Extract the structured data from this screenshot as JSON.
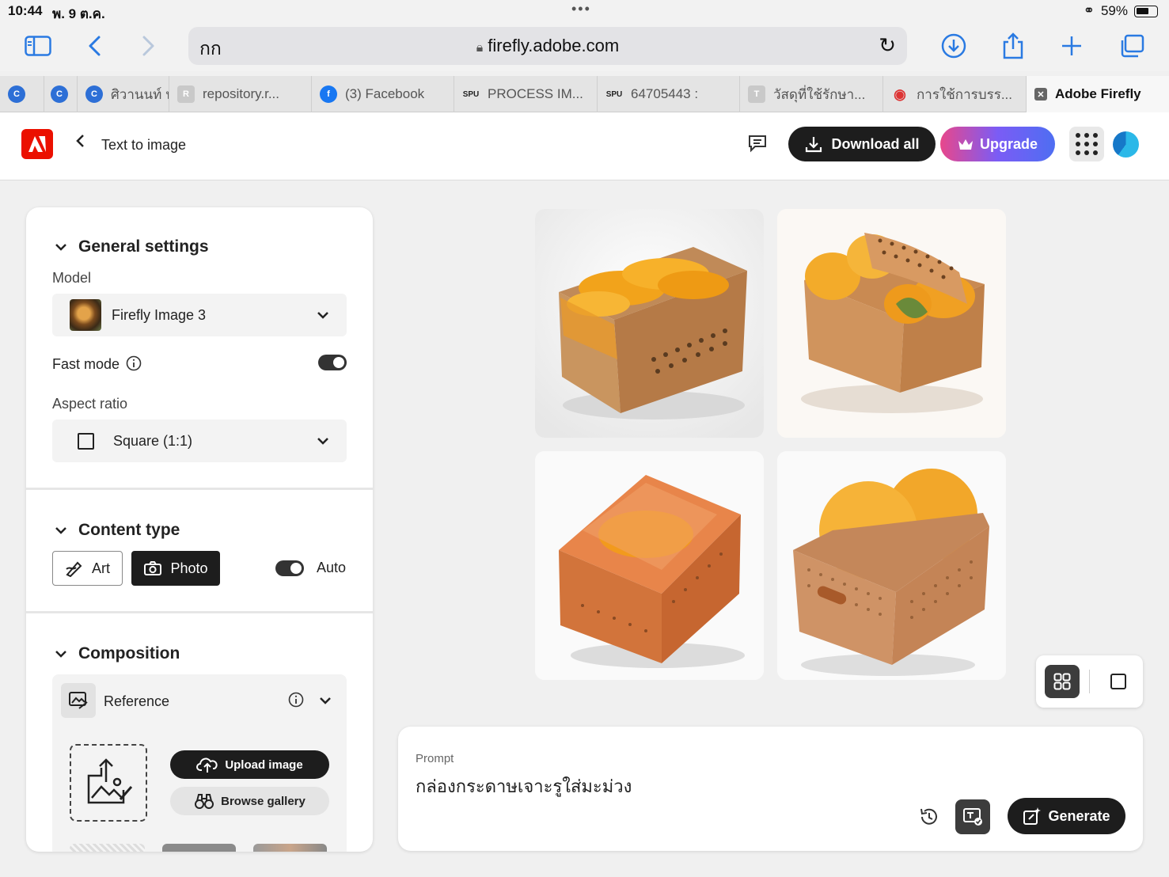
{
  "status": {
    "time": "10:44",
    "date": "พ. 9 ต.ค.",
    "battery": "59%"
  },
  "browser": {
    "aa_label": "กก",
    "url": "firefly.adobe.com",
    "tabs": [
      {
        "label": "",
        "fav": "C",
        "color": "#2d6fd6"
      },
      {
        "label": "",
        "fav": "C",
        "color": "#2d6fd6"
      },
      {
        "label": "ศิวานนท์ นั",
        "fav": "C",
        "color": "#2d6fd6"
      },
      {
        "label": "repository.r...",
        "fav": "R",
        "color": "#bbb"
      },
      {
        "label": "(3) Facebook",
        "fav": "f",
        "color": "#1877f2"
      },
      {
        "label": "PROCESS IM...",
        "fav": "SPU",
        "color": "#c2185b"
      },
      {
        "label": "64705443 :",
        "fav": "SPU",
        "color": "#c2185b"
      },
      {
        "label": "วัสดุที่ใช้รักษา...",
        "fav": "T",
        "color": "#bbb"
      },
      {
        "label": "การใช้การบรร...",
        "fav": "◉",
        "color": "#d33"
      },
      {
        "label": "Adobe Firefly",
        "fav": "✕",
        "color": "#666"
      }
    ]
  },
  "header": {
    "breadcrumb": "Text to image",
    "download_all": "Download all",
    "upgrade": "Upgrade"
  },
  "settings": {
    "general_title": "General settings",
    "model_label": "Model",
    "model_value": "Firefly Image 3",
    "fast_mode_label": "Fast mode",
    "fast_mode_on": true,
    "aspect_label": "Aspect ratio",
    "aspect_value": "Square (1:1)",
    "content_title": "Content type",
    "art_label": "Art",
    "photo_label": "Photo",
    "auto_label": "Auto",
    "composition_title": "Composition",
    "reference_label": "Reference",
    "upload_label": "Upload image",
    "browse_label": "Browse gallery"
  },
  "prompt": {
    "label": "Prompt",
    "text": "กล่องกระดาษเจาะรูใส่มะม่วง",
    "generate_label": "Generate"
  }
}
